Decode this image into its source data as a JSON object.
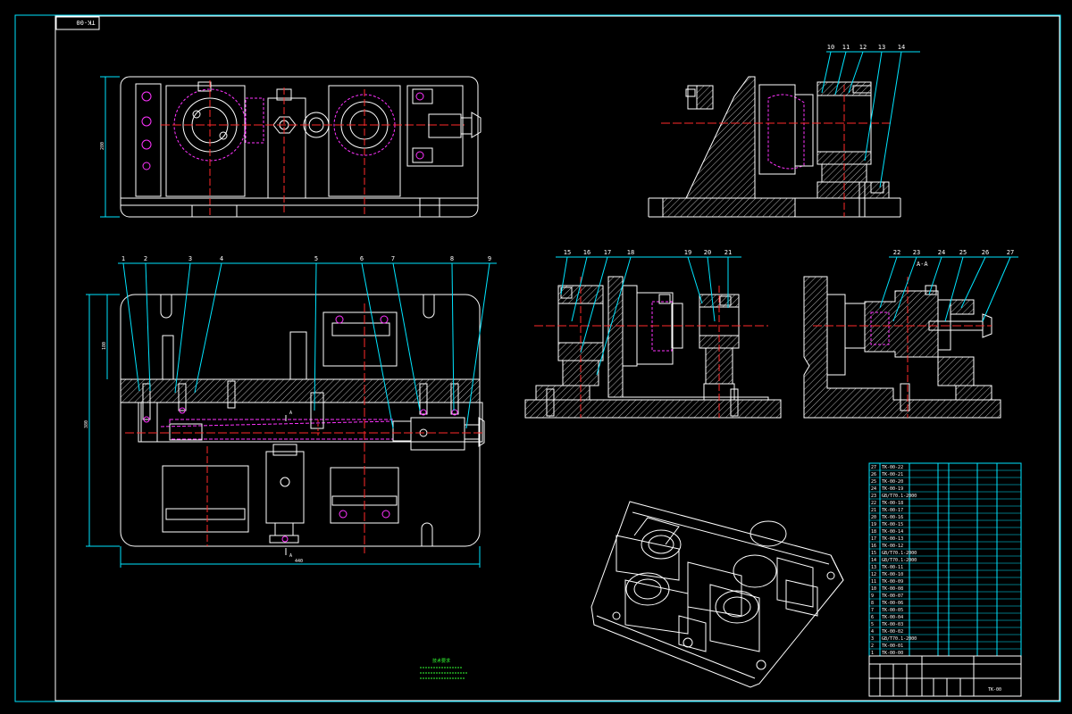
{
  "drawing": {
    "corner_code": "TK-00",
    "section_label": "A-A",
    "cut_marker": "A",
    "balloons_top": [
      "10",
      "11",
      "12",
      "13",
      "14"
    ],
    "balloons_front": [
      "1",
      "2",
      "3",
      "4",
      "5",
      "6",
      "7",
      "8",
      "9"
    ],
    "balloons_side_left": [
      "15",
      "16",
      "17",
      "18",
      "19",
      "20",
      "21"
    ],
    "balloons_side_right": [
      "22",
      "23",
      "24",
      "25",
      "26",
      "27"
    ],
    "tech_note_title": "技术要求",
    "colors": {
      "frame": "#00e5ff",
      "outline": "#ffffff",
      "centerline": "#ff2a2a",
      "hidden": "#ff33ff",
      "note": "#33ff33"
    }
  },
  "bom": {
    "rows": [
      {
        "no": "27",
        "code": "TK-00-22"
      },
      {
        "no": "26",
        "code": "TK-00-21"
      },
      {
        "no": "25",
        "code": "TK-00-20"
      },
      {
        "no": "24",
        "code": "TK-00-19"
      },
      {
        "no": "23",
        "code": "GB/T70.1-2000"
      },
      {
        "no": "22",
        "code": "TK-00-18"
      },
      {
        "no": "21",
        "code": "TK-00-17"
      },
      {
        "no": "20",
        "code": "TK-00-16"
      },
      {
        "no": "19",
        "code": "TK-00-15"
      },
      {
        "no": "18",
        "code": "TK-00-14"
      },
      {
        "no": "17",
        "code": "TK-00-13"
      },
      {
        "no": "16",
        "code": "TK-00-12"
      },
      {
        "no": "15",
        "code": "GB/T70.1-2000"
      },
      {
        "no": "14",
        "code": "GB/T70.1-2000"
      },
      {
        "no": "13",
        "code": "TK-00-11"
      },
      {
        "no": "12",
        "code": "TK-00-10"
      },
      {
        "no": "11",
        "code": "TK-00-09"
      },
      {
        "no": "10",
        "code": "TK-00-08"
      },
      {
        "no": "9",
        "code": "TK-00-07"
      },
      {
        "no": "8",
        "code": "TK-00-06"
      },
      {
        "no": "7",
        "code": "TK-00-05"
      },
      {
        "no": "6",
        "code": "TK-00-04"
      },
      {
        "no": "5",
        "code": "TK-00-03"
      },
      {
        "no": "4",
        "code": "TK-00-02"
      },
      {
        "no": "3",
        "code": "GB/T70.1-2000"
      },
      {
        "no": "2",
        "code": "TK-00-01"
      },
      {
        "no": "1",
        "code": "TK-00-00"
      }
    ],
    "title_block_code": "TK-00"
  }
}
